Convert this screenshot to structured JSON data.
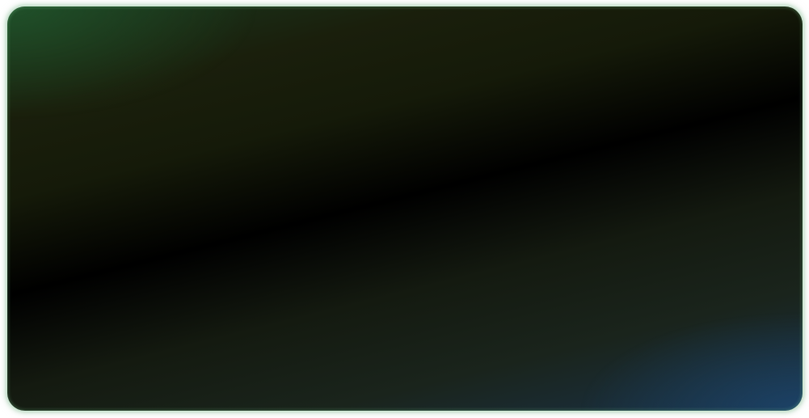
{
  "panel": {
    "colors": {
      "top_left": "#1a3a20",
      "center": "#000000",
      "bottom_right": "#1a3248",
      "glow_green": "#3ca05a",
      "glow_blue": "#1e5082"
    }
  }
}
